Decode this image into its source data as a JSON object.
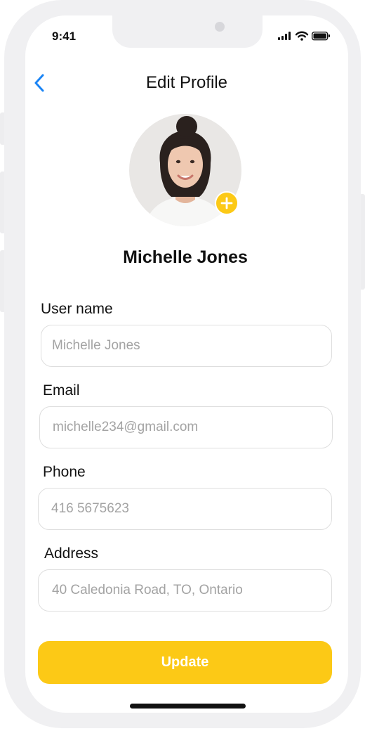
{
  "status_bar": {
    "time": "9:41",
    "icons": [
      "cellular-signal-icon",
      "wifi-icon",
      "battery-icon"
    ]
  },
  "header": {
    "back_icon": "chevron-left-icon",
    "title": "Edit Profile"
  },
  "profile": {
    "avatar_icon": "profile-photo",
    "add_photo_icon": "plus-icon",
    "name": "Michelle Jones"
  },
  "form": {
    "username": {
      "label": "User name",
      "placeholder": "Michelle Jones"
    },
    "email": {
      "label": "Email",
      "placeholder": "michelle234@gmail.com"
    },
    "phone": {
      "label": "Phone",
      "placeholder": "416 5675623"
    },
    "address": {
      "label": "Address",
      "placeholder": "40 Caledonia Road, TO, Ontario"
    }
  },
  "update_button": {
    "label": "Update"
  },
  "colors": {
    "accent": "#fcc916",
    "back_link": "#1a84f5",
    "frame": "#f0f0f2",
    "input_border": "#dedede",
    "placeholder": "#a3a3a3"
  }
}
